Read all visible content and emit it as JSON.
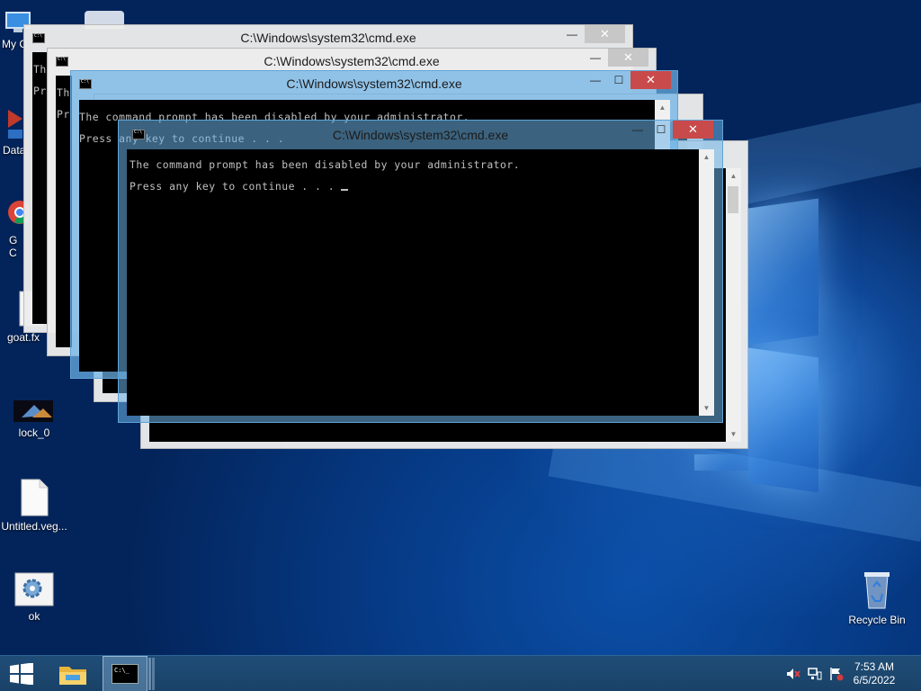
{
  "desktop": {
    "icons": [
      {
        "label": "My C",
        "icon": "computer-icon"
      },
      {
        "label": "Data",
        "icon": "app-icon"
      },
      {
        "label": "G",
        "icon": "chrome-icon"
      },
      {
        "label": "C",
        "icon": "chrome-icon"
      },
      {
        "label": "goat.fx",
        "icon": "file-icon"
      },
      {
        "label": "lock_0",
        "icon": "image-file-icon"
      },
      {
        "label": "Untitled.veg...",
        "icon": "blank-file-icon"
      },
      {
        "label": "ok",
        "icon": "settings-file-icon"
      },
      {
        "label": "Recycle Bin",
        "icon": "recycle-bin-icon"
      }
    ]
  },
  "windows": {
    "title": "C:\\Windows\\system32\\cmd.exe",
    "line1": "The command prompt has been disabled by your administrator.",
    "line2": "Press any key to continue . . . ",
    "clip1": "Th",
    "clip2": "Pr",
    "active_line2_faded": "Press any key to continue . . .",
    "min_symbol": "—",
    "max_symbol": "☐",
    "close_symbol": "✕"
  },
  "taskbar": {
    "start_icon": "windows-start-icon",
    "explorer_icon": "file-explorer-icon",
    "cmd_icon": "command-prompt-icon",
    "tray": [
      "speaker-muted-icon",
      "network-icon",
      "action-center-flag-icon"
    ],
    "time": "7:53 AM",
    "date": "6/5/2022"
  },
  "colors": {
    "accent_active": "#6cb2e6",
    "close_red": "#c94a4a",
    "console_text": "#c0c0c0",
    "taskbar": "#1f4d77"
  }
}
